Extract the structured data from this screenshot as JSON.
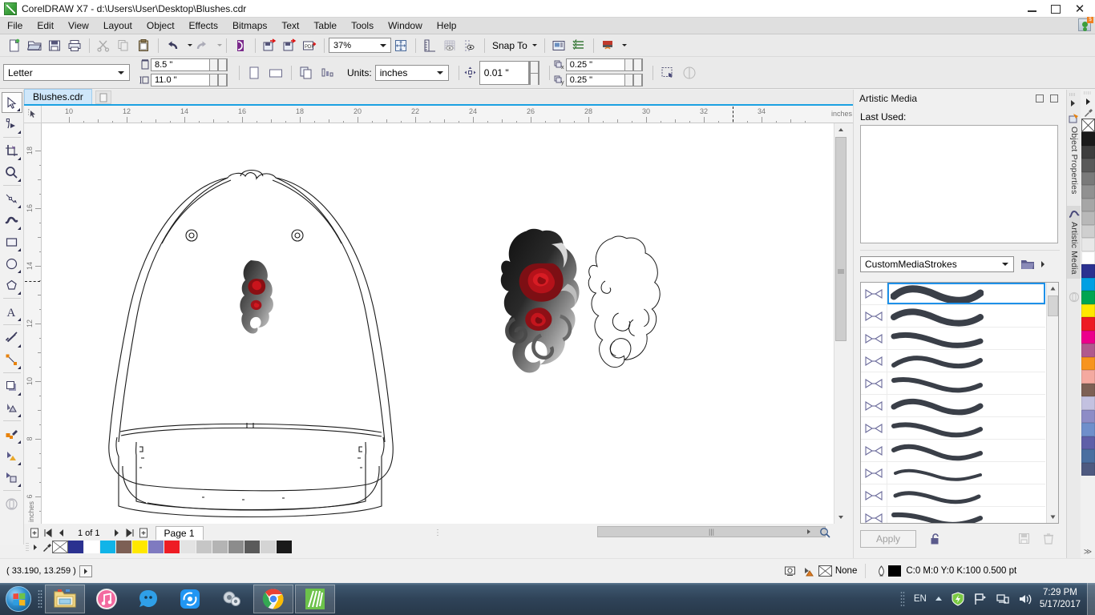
{
  "window": {
    "title": "CorelDRAW X7 - d:\\Users\\User\\Desktop\\Blushes.cdr",
    "app_icon": "coreldraw-logo-icon",
    "minimize": "–",
    "restore": "❐",
    "close": "✕"
  },
  "menu": {
    "items": [
      {
        "label": "File"
      },
      {
        "label": "Edit"
      },
      {
        "label": "View"
      },
      {
        "label": "Layout"
      },
      {
        "label": "Object"
      },
      {
        "label": "Effects"
      },
      {
        "label": "Bitmaps"
      },
      {
        "label": "Text"
      },
      {
        "label": "Table"
      },
      {
        "label": "Tools"
      },
      {
        "label": "Window"
      },
      {
        "label": "Help"
      }
    ]
  },
  "standard_toolbar": {
    "buttons": [
      {
        "name": "new-document",
        "icon": "new-page-icon"
      },
      {
        "name": "open-document",
        "icon": "open-folder-icon"
      },
      {
        "name": "save-document",
        "icon": "floppy-disk-icon"
      },
      {
        "name": "print",
        "icon": "printer-icon"
      },
      {
        "name": "cut",
        "icon": "scissors-icon"
      },
      {
        "name": "copy",
        "icon": "copy-icon"
      },
      {
        "name": "paste",
        "icon": "clipboard-icon"
      },
      {
        "name": "undo",
        "icon": "undo-arrow-icon"
      },
      {
        "name": "redo",
        "icon": "redo-arrow-icon"
      },
      {
        "name": "import",
        "icon": "import-icon"
      },
      {
        "name": "export",
        "icon": "export-icon"
      },
      {
        "name": "publish-pdf",
        "icon": "pdf-icon"
      }
    ],
    "zoom_level": "37%",
    "zoom_fit": "zoom-to-fit-icon",
    "show_rulers": "ruler-icon",
    "show_grid": "grid-icon",
    "show_guides": "guides-icon",
    "snap_to_label": "Snap To",
    "options": "options-icon",
    "object_manager": "object-manager-icon",
    "application_launcher": "launcher-icon"
  },
  "property_bar": {
    "paper_type": "Letter",
    "page_width": "8.5 \"",
    "page_height": "11.0 \"",
    "orientation_portrait": "portrait-icon",
    "orientation_landscape": "landscape-icon",
    "all_pages": "all-pages-icon",
    "current_page": "current-page-icon",
    "units_label": "Units:",
    "units_value": "inches",
    "nudge_value": "0.01 \"",
    "duplicate_x_label": "x",
    "duplicate_x": "0.25 \"",
    "duplicate_y_label": "y",
    "duplicate_y": "0.25 \"",
    "treat_as_filled": "treat-as-filled-icon",
    "wrap_paragraph": "wrap-text-icon"
  },
  "document_tabs": {
    "tabs": [
      {
        "label": "Blushes.cdr",
        "active": true
      }
    ],
    "new_tab": "new-tab-icon"
  },
  "toolbox": {
    "tools": [
      {
        "name": "pick-tool",
        "icon": "arrow-cursor-icon",
        "selected": true
      },
      {
        "name": "shape-tool",
        "icon": "node-edit-icon",
        "selected": false
      },
      {
        "name": "crop-tool",
        "icon": "crop-icon",
        "selected": false
      },
      {
        "name": "zoom-tool",
        "icon": "magnifier-icon",
        "selected": false
      },
      {
        "name": "freehand-tool",
        "icon": "freehand-line-icon",
        "selected": false
      },
      {
        "name": "artistic-media-tool",
        "icon": "artistic-media-brush-icon",
        "selected": false
      },
      {
        "name": "rectangle-tool",
        "icon": "rectangle-icon",
        "selected": false
      },
      {
        "name": "ellipse-tool",
        "icon": "ellipse-icon",
        "selected": false
      },
      {
        "name": "polygon-tool",
        "icon": "polygon-icon",
        "selected": false
      },
      {
        "name": "text-tool",
        "icon": "letter-a-icon",
        "selected": false
      },
      {
        "name": "parallel-dimension-tool",
        "icon": "dimension-icon",
        "selected": false
      },
      {
        "name": "straight-line-connector-tool",
        "icon": "connector-icon",
        "selected": false
      },
      {
        "name": "drop-shadow-tool",
        "icon": "shadow-icon",
        "selected": false
      },
      {
        "name": "transparency-tool",
        "icon": "transparency-icon",
        "selected": false
      },
      {
        "name": "color-eyedropper-tool",
        "icon": "eyedropper-icon",
        "selected": false
      },
      {
        "name": "interactive-fill-tool",
        "icon": "fill-icon",
        "selected": false
      },
      {
        "name": "smart-fill-tool",
        "icon": "smart-fill-icon",
        "selected": false
      },
      {
        "name": "outline-tool",
        "icon": "outline-pen-icon",
        "selected": false
      }
    ]
  },
  "rulers": {
    "horizontal_ticks": [
      "10",
      "12",
      "14",
      "16",
      "18",
      "20",
      "22",
      "24",
      "26",
      "28",
      "30",
      "32",
      "34"
    ],
    "horizontal_units": "inches",
    "vertical_ticks": [
      "18",
      "16",
      "14",
      "12",
      "10",
      "8",
      "6"
    ],
    "vertical_units": "inches"
  },
  "canvas": {
    "artwork": [
      {
        "name": "baseball-cap-outline-drawing"
      },
      {
        "name": "tribal-rose-tattoo-artwork"
      },
      {
        "name": "tribal-rose-outline-path"
      },
      {
        "name": "cap-logo-placement-artwork"
      }
    ]
  },
  "page_nav": {
    "add_page_start": "add-page-icon",
    "first_page": "⏮",
    "prev_page": "◀",
    "page_counter": "1 of 1",
    "next_page": "▶",
    "last_page": "⏭",
    "add_page_end": "add-page-icon",
    "page_tab": "Page 1"
  },
  "bottom_palette": {
    "no_color": "none-swatch",
    "colors": [
      "#2b3190",
      "#ffffff",
      "#11b4e8",
      "#7d6055",
      "#ffe800",
      "#7f7ac0",
      "#ee1c24",
      "#e3e3e3",
      "#c6c6c6",
      "#b4b4b4",
      "#8c8c8c",
      "#5a5a5a",
      "#d4d4d4",
      "#1a1a1a"
    ]
  },
  "status_bar": {
    "coordinates": "( 33.190, 13.259 )",
    "expand_button": "▶",
    "screen_icon": "screen-mode-icon",
    "fill_icon": "fill-bucket-icon",
    "fill_value": "None",
    "outline_icon": "outline-pen-icon",
    "outline_color_swatch": "#000000",
    "outline_value": "C:0 M:0 Y:0 K:100  0.500 pt"
  },
  "docker": {
    "title": "Artistic Media",
    "collapse_icon": "collapse-icon",
    "close_icon": "close-icon",
    "last_used_label": "Last Used:",
    "media_category": "CustomMediaStrokes",
    "browse_icon": "folder-open-icon",
    "flyout_icon": "flyout-arrow-icon",
    "strokes": [
      {
        "index": 1,
        "selected": true,
        "shape": "tapered-thick-wave"
      },
      {
        "index": 2,
        "selected": false,
        "shape": "round-end-wave"
      },
      {
        "index": 3,
        "selected": false,
        "shape": "flat-end-wave"
      },
      {
        "index": 4,
        "selected": false,
        "shape": "pointed-wave"
      },
      {
        "index": 5,
        "selected": false,
        "shape": "flat-start-taper-wave"
      },
      {
        "index": 6,
        "selected": false,
        "shape": "uniform-round-wave"
      },
      {
        "index": 7,
        "selected": false,
        "shape": "chisel-wave"
      },
      {
        "index": 8,
        "selected": false,
        "shape": "calligraphic-wave"
      },
      {
        "index": 9,
        "selected": false,
        "shape": "bulb-start-thin-wave"
      },
      {
        "index": 10,
        "selected": false,
        "shape": "bulb-both-ends-wave"
      },
      {
        "index": 11,
        "selected": false,
        "shape": "wedge-wave"
      }
    ],
    "apply_label": "Apply",
    "lock_icon": "unlocked-padlock-icon",
    "save_icon": "save-stroke-icon",
    "delete_icon": "trash-can-icon",
    "scroll_up": "▲",
    "scroll_down": "▼"
  },
  "docker_tabs": [
    {
      "label": "Object Properties",
      "icon": "object-properties-icon",
      "active": false
    },
    {
      "label": "Artistic Media",
      "icon": "artistic-media-icon",
      "active": true
    }
  ],
  "color_palette": {
    "no_color": "none-swatch",
    "eyedropper": "eyedropper-icon",
    "scroll_arrow": "▶",
    "more_arrow": "≫",
    "colors": [
      "#1a1a1a",
      "#3d3d3d",
      "#595959",
      "#7a7a7a",
      "#919191",
      "#a6a6a6",
      "#b8b8b8",
      "#cfcfcf",
      "#e8e8e8",
      "#ffffff",
      "#2b3190",
      "#00a0e3",
      "#00a551",
      "#ffe800",
      "#ed1c24",
      "#ec008c",
      "#b05a8e",
      "#f7941e",
      "#f4a9a0",
      "#7d6055",
      "#c3c1e0",
      "#8e8cc6",
      "#6f8fcb",
      "#5f5fa8",
      "#4a6fa0",
      "#4e5a80"
    ]
  },
  "taskbar": {
    "start_button": "windows-start-orb",
    "items": [
      {
        "name": "file-explorer",
        "icon": "folder-icon",
        "pinned": true
      },
      {
        "name": "itunes",
        "icon": "music-note-icon",
        "pinned": false
      },
      {
        "name": "messenger",
        "icon": "blue-blob-icon",
        "pinned": false
      },
      {
        "name": "shareit",
        "icon": "share-icon",
        "pinned": false
      },
      {
        "name": "utility-app",
        "icon": "gears-icon",
        "pinned": false
      },
      {
        "name": "google-chrome",
        "icon": "chrome-icon",
        "pinned": true
      },
      {
        "name": "coreldraw",
        "icon": "coreldraw-icon",
        "pinned": true
      }
    ],
    "tray": {
      "language": "EN",
      "show_hidden": "▲",
      "antivirus": "shield-icon",
      "flag": "action-center-flag-icon",
      "network": "network-icon",
      "volume": "speaker-icon",
      "time": "7:29 PM",
      "date": "5/17/2017"
    }
  }
}
